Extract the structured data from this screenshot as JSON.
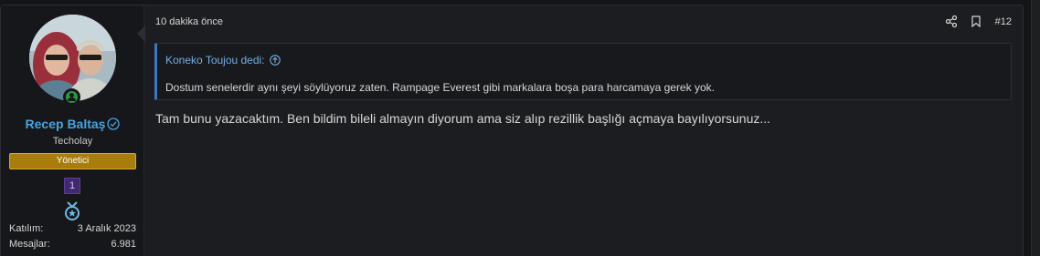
{
  "post": {
    "date": "10 dakika önce",
    "post_number": "#12",
    "quote": {
      "author": "Koneko Toujou dedi:",
      "text": "Dostum senelerdir aynı şeyi söylüyoruz zaten. Rampage Everest gibi markalara boşa para harcamaya gerek yok."
    },
    "body": "Tam bunu yazacaktım. Ben bildim bileli almayın diyorum ama siz alıp rezillik başlığı açmaya bayılıyorsunuz..."
  },
  "user": {
    "name": "Recep Baltaş",
    "title": "Techolay",
    "role": "Yönetici",
    "level": "1",
    "stats": [
      {
        "label": "Katılım:",
        "value": "3 Aralık 2023"
      },
      {
        "label": "Mesajlar:",
        "value": "6.981"
      }
    ]
  },
  "colors": {
    "username": "#4aa3df",
    "role_badge": "#a87d0e",
    "quote_accent": "#3b79c2",
    "online": "#2b9a3e"
  },
  "icons": [
    "verified-icon",
    "online-status-icon",
    "medal-icon",
    "share-icon",
    "bookmark-icon",
    "quote-link-icon"
  ]
}
